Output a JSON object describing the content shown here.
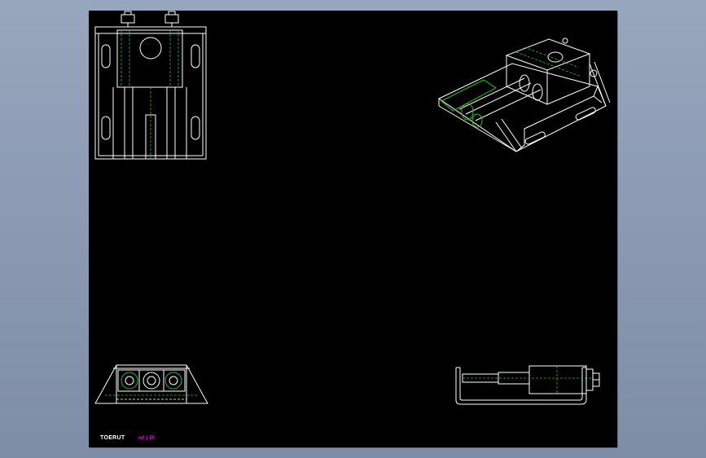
{
  "drawing": {
    "sheet_background": "#000000",
    "window_background": "#8a99b2",
    "line_color": "#ffffff",
    "hidden_line_color": "#27c027",
    "title_label": "TOERUT",
    "scale_label": "ref 1:50",
    "scale_color": "#ff33ff"
  }
}
